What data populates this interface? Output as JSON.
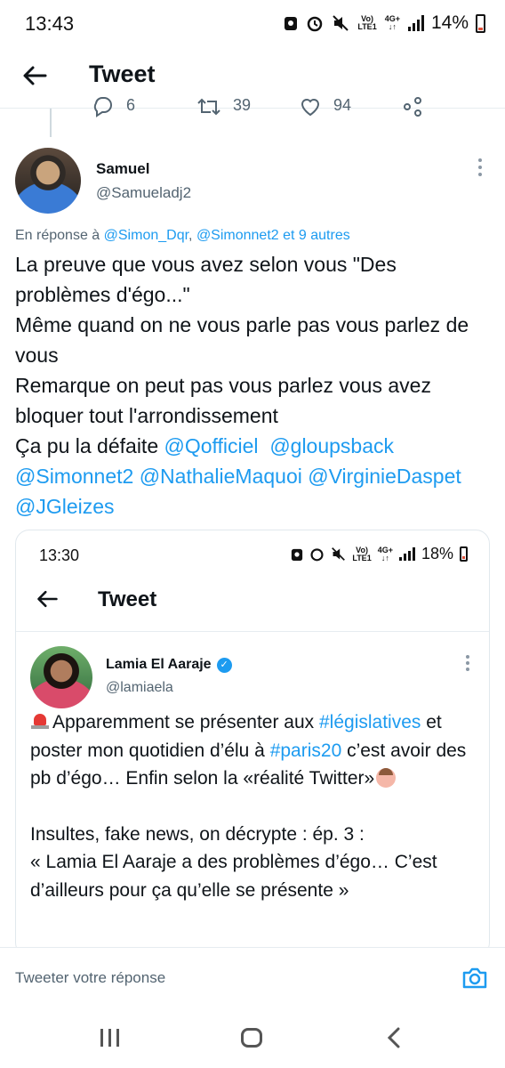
{
  "status_bar": {
    "time": "13:43",
    "network_top": "Vo)",
    "network_bottom": "LTE1",
    "data_type": "4G+",
    "battery": "14%"
  },
  "header": {
    "title": "Tweet"
  },
  "previous_tweet_actions": {
    "replies": "6",
    "retweets": "39",
    "likes": "94"
  },
  "tweet": {
    "author_name": "Samuel",
    "author_handle": "@Samueladj2",
    "replying_prefix": "En réponse à",
    "replying_user1": "@Simon_Dqr",
    "replying_sep": ",",
    "replying_user2": "@Simonnet2",
    "replying_others": "et 9 autres",
    "line1": "La preuve que vous avez selon vous \"Des problèmes d'égo...\"",
    "line2": "Même quand on ne vous parle pas vous parlez de vous",
    "line3": "Remarque on peut pas vous parlez vous avez bloquer tout l'arrondissement",
    "line4_text": "Ça pu la défaite",
    "mention_1": "@Qofficiel",
    "mention_2": "@gloupsback",
    "mention_3": "@Simonnet2",
    "mention_4": "@NathalieMaquoi",
    "mention_5": "@VirginieDaspet",
    "mention_6": "@JGleizes"
  },
  "embedded_screenshot": {
    "time": "13:30",
    "network_top": "Vo)",
    "network_bottom": "LTE1",
    "data_type": "4G+",
    "battery": "18%",
    "header_title": "Tweet",
    "author_name": "Lamia El Aaraje",
    "author_handle": "@lamiaela",
    "text_part1": "Apparemment se présenter aux ",
    "hashtag1": "#législatives",
    "text_part2": " et poster mon quotidien d’élu à ",
    "hashtag2": "#paris20",
    "text_part3": " c’est avoir des pb d’égo… Enfin selon la «réalité Twitter»",
    "para2_line1": "Insultes, fake news, on décrypte : ép. 3 :",
    "para2_line2": "« Lamia El Aaraje a des problèmes d’égo… C’est d’ailleurs pour ça qu’elle se présente »"
  },
  "reply_bar": {
    "placeholder": "Tweeter votre réponse"
  },
  "colors": {
    "link": "#1d9bf0",
    "secondary_text": "#536471",
    "primary_text": "#0f1419"
  },
  "icons": [
    "back-arrow-icon",
    "more-vertical-icon",
    "verified-badge-icon",
    "camera-icon",
    "reply-icon",
    "retweet-icon",
    "like-icon",
    "share-icon"
  ]
}
